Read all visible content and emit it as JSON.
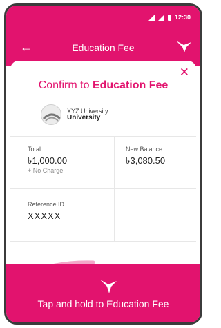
{
  "status": {
    "time": "12:30"
  },
  "appbar": {
    "title": "Education Fee"
  },
  "confirm": {
    "prefix": "Confirm to",
    "target": "Education Fee"
  },
  "biller": {
    "line1": "XYZ University",
    "line2": "University"
  },
  "details": {
    "total_label": "Total",
    "total_value": "৳1,000.00",
    "charge_note": "+ No Charge",
    "balance_label": "New Balance",
    "balance_value": "৳3,080.50",
    "reference_label": "Reference ID",
    "reference_value": "XXXXX"
  },
  "action": {
    "tap_label": "Tap and hold to Education Fee"
  },
  "colors": {
    "brand": "#e2136e"
  }
}
